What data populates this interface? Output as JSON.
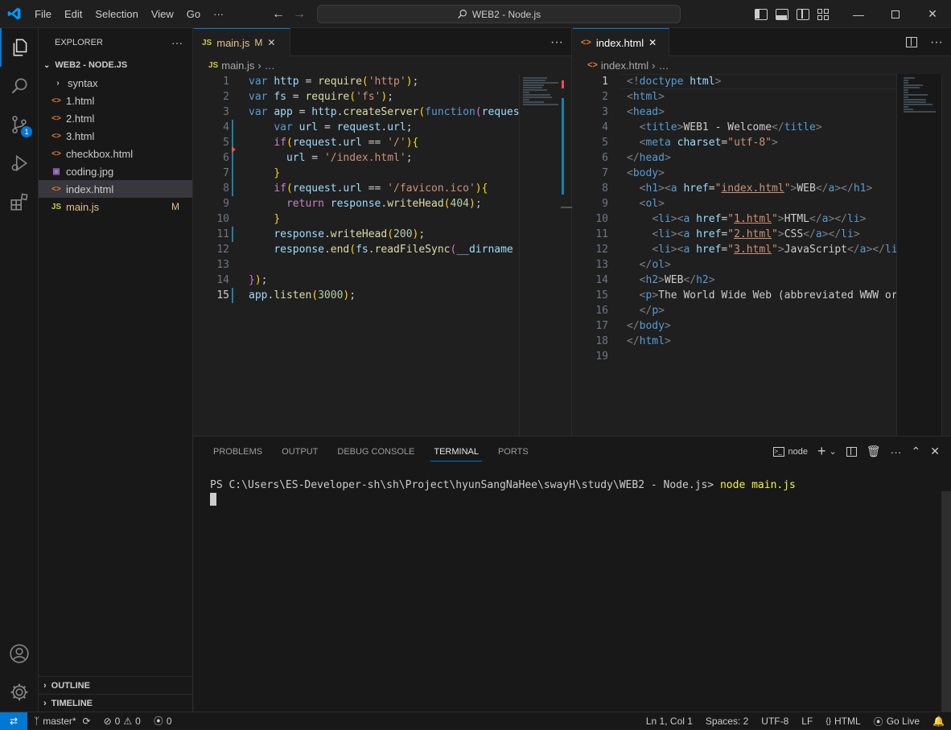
{
  "titlebar": {
    "menus": [
      "File",
      "Edit",
      "Selection",
      "View",
      "Go",
      "···"
    ],
    "command_center": "WEB2 - Node.js"
  },
  "activity": {
    "scm_badge": "1"
  },
  "sidebar": {
    "title": "EXPLORER",
    "more": "···",
    "root": "WEB2 - NODE.JS",
    "items": [
      {
        "name": "syntax",
        "icon": "›",
        "color": "#cccccc",
        "type": "folder"
      },
      {
        "name": "1.html",
        "icon": "<>",
        "color": "#e37933",
        "type": "html"
      },
      {
        "name": "2.html",
        "icon": "<>",
        "color": "#e37933",
        "type": "html"
      },
      {
        "name": "3.html",
        "icon": "<>",
        "color": "#e37933",
        "type": "html"
      },
      {
        "name": "checkbox.html",
        "icon": "<>",
        "color": "#e37933",
        "type": "html"
      },
      {
        "name": "coding.jpg",
        "icon": "▣",
        "color": "#a074c4",
        "type": "image"
      },
      {
        "name": "index.html",
        "icon": "<>",
        "color": "#e37933",
        "type": "html"
      },
      {
        "name": "main.js",
        "icon": "JS",
        "color": "#cbcb41",
        "type": "js",
        "badge": "M"
      }
    ],
    "outline": "OUTLINE",
    "timeline": "TIMELINE"
  },
  "left_editor": {
    "tab_label": "main.js",
    "tab_badge": "M",
    "crumb_file": "main.js",
    "crumb_more": "…",
    "more": "···",
    "line_numbers": [
      "1",
      "2",
      "3",
      "4",
      "5",
      "6",
      "7",
      "8",
      "9",
      "10",
      "11",
      "12",
      "13",
      "14",
      "15"
    ]
  },
  "right_editor": {
    "tab_label": "index.html",
    "crumb_file": "index.html",
    "crumb_more": "…",
    "line_numbers": [
      "1",
      "2",
      "3",
      "4",
      "5",
      "6",
      "7",
      "8",
      "9",
      "10",
      "11",
      "12",
      "13",
      "14",
      "15",
      "16",
      "17",
      "18",
      "19"
    ]
  },
  "panel": {
    "tabs": [
      "PROBLEMS",
      "OUTPUT",
      "DEBUG CONSOLE",
      "TERMINAL",
      "PORTS"
    ],
    "active_tab": "TERMINAL",
    "terminal_name": "node",
    "prompt": "PS C:\\Users\\ES-Developer-sh\\sh\\Project\\hyunSangNaHee\\swayH\\study\\WEB2 - Node.js> ",
    "command": "node main.js"
  },
  "status": {
    "branch": "master*",
    "errors": "0",
    "warnings": "0",
    "ports": "0",
    "position": "Ln 1, Col 1",
    "spaces": "Spaces: 2",
    "encoding": "UTF-8",
    "eol": "LF",
    "language": "HTML",
    "golive": "Go Live"
  },
  "colors": {
    "accent": "#0078d4",
    "modified": "#e2c08d"
  }
}
